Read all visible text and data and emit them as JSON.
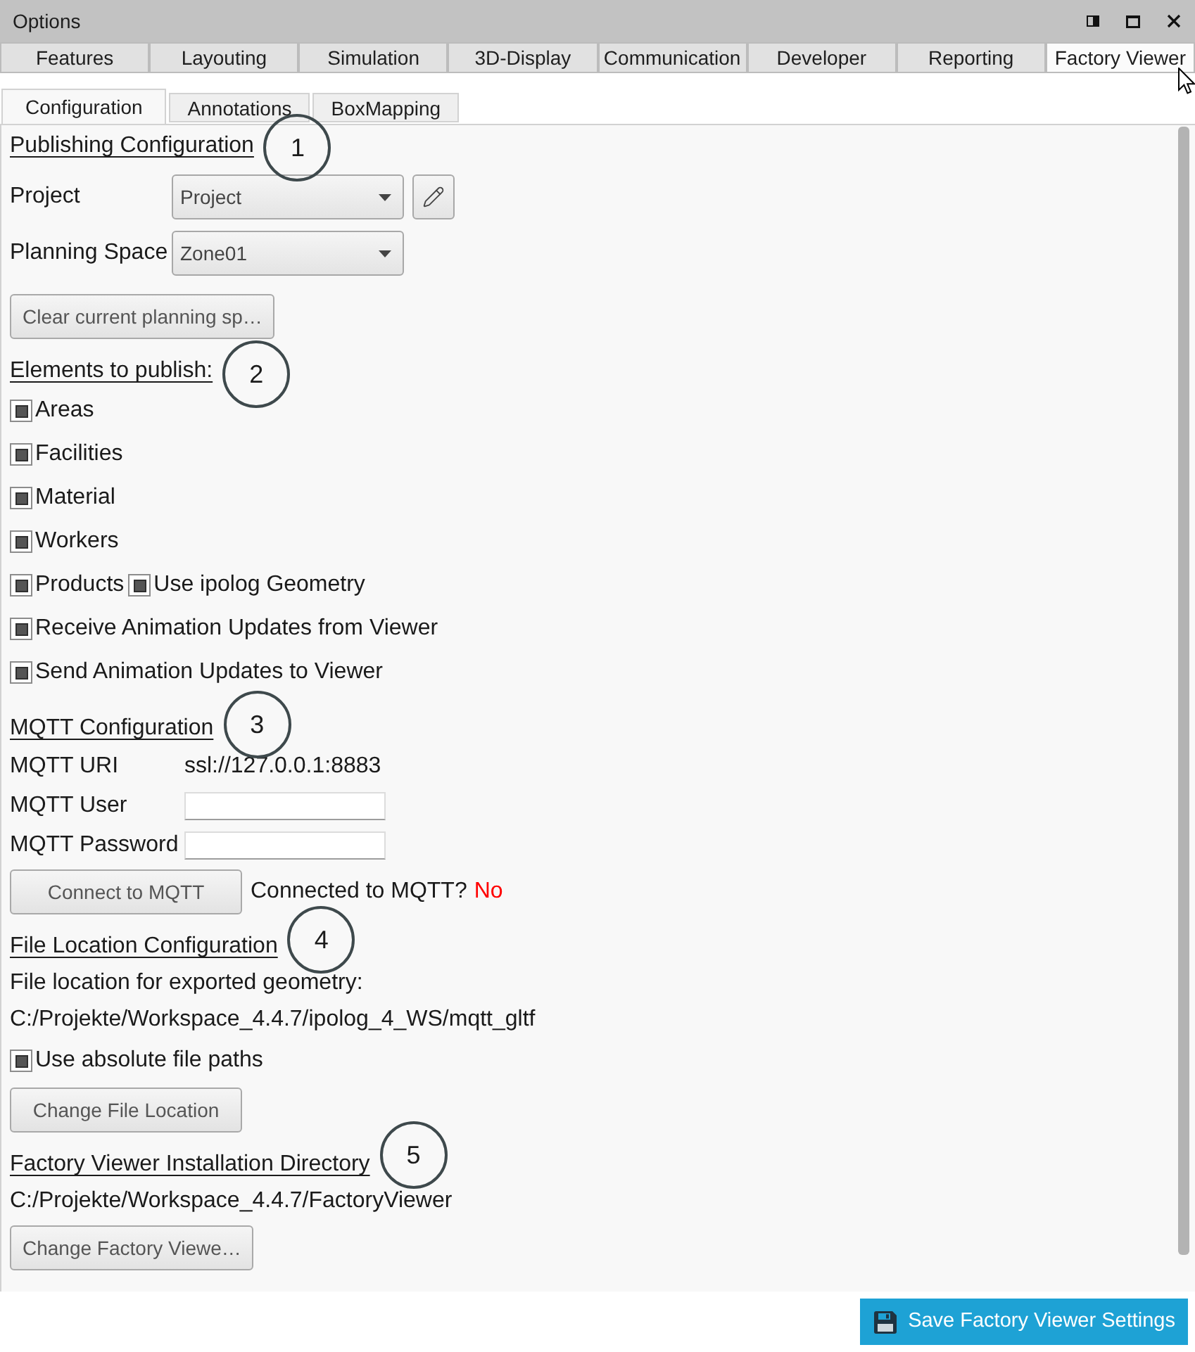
{
  "window": {
    "title": "Options"
  },
  "tabs": [
    {
      "label": "Features",
      "selected": false
    },
    {
      "label": "Layouting",
      "selected": false
    },
    {
      "label": "Simulation",
      "selected": false
    },
    {
      "label": "3D-Display",
      "selected": false
    },
    {
      "label": "Communication",
      "selected": false
    },
    {
      "label": "Developer",
      "selected": false
    },
    {
      "label": "Reporting",
      "selected": false
    },
    {
      "label": "Factory Viewer",
      "selected": true
    }
  ],
  "subtabs": [
    {
      "label": "Configuration",
      "selected": true
    },
    {
      "label": "Annotations",
      "selected": false
    },
    {
      "label": "BoxMapping",
      "selected": false
    }
  ],
  "sections": [
    {
      "heading": "Publishing Configuration",
      "callout": "1",
      "items": [
        {
          "kind": "select",
          "label": "Project",
          "value": "Project",
          "edit_button": true
        },
        {
          "kind": "select",
          "label": "Planning Space",
          "value": "Zone01",
          "edit_button": false
        },
        {
          "kind": "button",
          "label": "Clear current planning sp…"
        }
      ]
    },
    {
      "heading": "Elements to publish:",
      "callout": "2",
      "items": [
        {
          "kind": "checkbox",
          "checks": [
            {
              "label": "Areas",
              "checked": true
            }
          ]
        },
        {
          "kind": "checkbox",
          "checks": [
            {
              "label": "Facilities",
              "checked": true
            }
          ]
        },
        {
          "kind": "checkbox",
          "checks": [
            {
              "label": "Material",
              "checked": true
            }
          ]
        },
        {
          "kind": "checkbox",
          "checks": [
            {
              "label": "Workers",
              "checked": true
            }
          ]
        },
        {
          "kind": "checkbox",
          "checks": [
            {
              "label": "Products",
              "checked": true
            },
            {
              "label": "Use ipolog Geometry",
              "checked": true
            }
          ]
        },
        {
          "kind": "checkbox",
          "checks": [
            {
              "label": "Receive Animation Updates from Viewer",
              "checked": true
            }
          ]
        },
        {
          "kind": "checkbox",
          "checks": [
            {
              "label": "Send Animation Updates to Viewer",
              "checked": true
            }
          ]
        }
      ]
    },
    {
      "heading": "MQTT Configuration",
      "callout": "3",
      "items": [
        {
          "kind": "readout",
          "label": "MQTT URI",
          "value": "ssl://127.0.0.1:8883"
        },
        {
          "kind": "input",
          "label": "MQTT User"
        },
        {
          "kind": "input",
          "label": "MQTT Password"
        },
        {
          "kind": "connect",
          "button": "Connect to MQTT",
          "status_label": "Connected to MQTT?",
          "status_value": "No",
          "connected": false
        }
      ]
    },
    {
      "heading": "File Location Configuration",
      "callout": "4",
      "items": [
        {
          "kind": "text",
          "text": "File location for exported geometry:"
        },
        {
          "kind": "path",
          "text": "C:/Projekte/Workspace_4.4.7/ipolog_4_WS/mqtt_gltf"
        },
        {
          "kind": "checkbox",
          "checks": [
            {
              "label": "Use absolute file paths",
              "checked": true
            }
          ]
        },
        {
          "kind": "button",
          "label": "Change File Location"
        }
      ]
    },
    {
      "heading": "Factory Viewer Installation Directory",
      "callout": "5",
      "items": [
        {
          "kind": "path",
          "text": "C:/Projekte/Workspace_4.4.7/FactoryViewer"
        },
        {
          "kind": "button",
          "label": "Change Factory Viewe…"
        }
      ]
    }
  ],
  "save_button": {
    "label": "Save Factory Viewer Settings"
  }
}
